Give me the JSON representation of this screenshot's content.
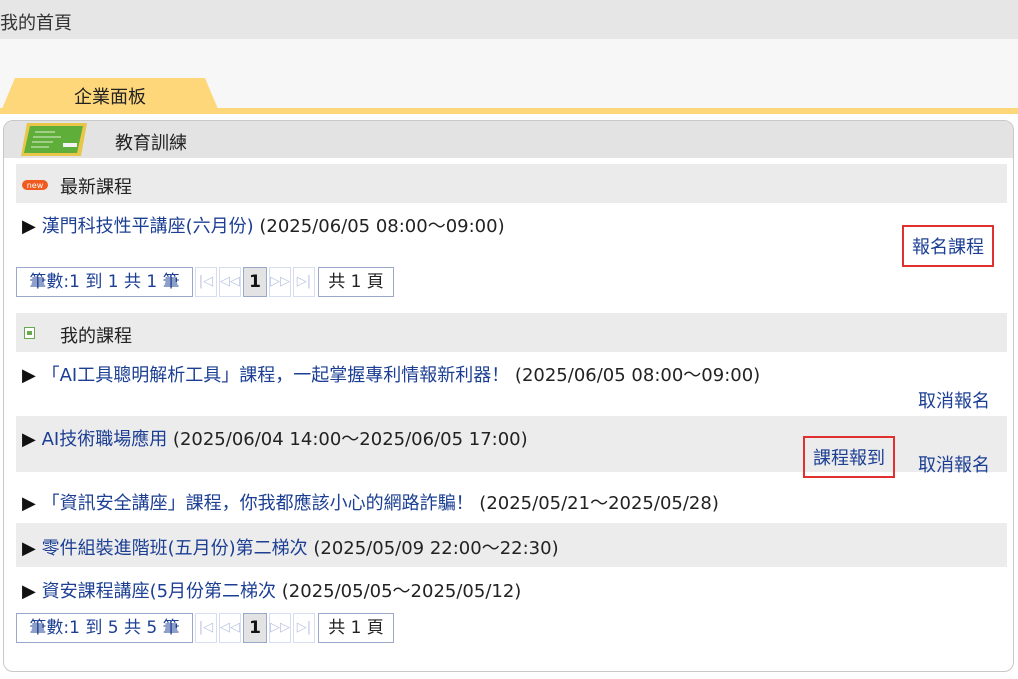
{
  "header": {
    "title": "我的首頁"
  },
  "tab": {
    "label": "企業面板"
  },
  "panel": {
    "title": "教育訓練"
  },
  "latest": {
    "badge": "new",
    "title": "最新課程",
    "items": [
      {
        "arrow": "▶",
        "name": "漢門科技性平講座(六月份)",
        "date": " (2025/06/05 08:00～09:00)",
        "action": "報名課程"
      }
    ],
    "pager": {
      "summary": "筆數:1 到 1 共 1 筆",
      "current": "1",
      "total": "共 1 頁"
    }
  },
  "mine": {
    "title": "我的課程",
    "items": [
      {
        "arrow": "▶",
        "name": "「AI工具聰明解析工具」課程，一起掌握專利情報新利器！",
        "date": " (2025/06/05 08:00～09:00)",
        "cancel": "取消報名"
      },
      {
        "arrow": "▶",
        "name": "AI技術職場應用",
        "date": " (2025/06/04 14:00～2025/06/05 17:00)",
        "checkin": "課程報到",
        "cancel": "取消報名"
      },
      {
        "arrow": "▶",
        "name": "「資訊安全講座」課程，你我都應該小心的網路詐騙！",
        "date": " (2025/05/21～2025/05/28)"
      },
      {
        "arrow": "▶",
        "name": "零件組裝進階班(五月份)第二梯次",
        "date": " (2025/05/09 22:00～22:30)"
      },
      {
        "arrow": "▶",
        "name": "資安課程講座(5月份第二梯次",
        "date": " (2025/05/05～2025/05/12)"
      }
    ],
    "pager": {
      "summary": "筆數:1 到 5 共 5 筆",
      "current": "1",
      "total": "共 1 頁"
    }
  },
  "colors": {
    "accent_tab": "#fdd77a",
    "link": "#1c3f94",
    "highlight_box": "#e03030",
    "badge": "#f05a1e",
    "doc_icon": "#6aa84f"
  }
}
